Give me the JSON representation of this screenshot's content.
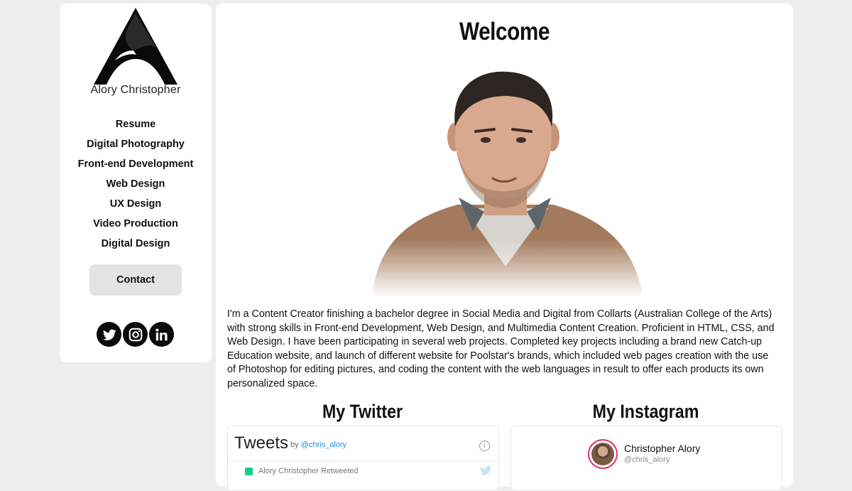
{
  "sidebar": {
    "logo_name": "Alory Christopher",
    "nav": [
      "Resume",
      "Digital Photography",
      "Front-end Development",
      "Web Design",
      "UX Design",
      "Video Production",
      "Digital Design"
    ],
    "contact_label": "Contact",
    "socials": [
      "twitter-icon",
      "instagram-icon",
      "linkedin-icon"
    ]
  },
  "main": {
    "title": "Welcome",
    "bio": "I'm a Content Creator finishing a bachelor degree in Social Media and Digital from Collarts (Australian College of the Arts) with strong skills in Front-end Development, Web Design, and Multimedia Content Creation. Proficient in HTML, CSS, and Web Design. I have been participating in several web projects. Completed key projects including a brand new Catch-up Education website, and launch of different website for Poolstar's brands, which included web pages creation with the use of Photoshop for editing pictures, and coding the content with the web languages in result to offer each products its own personalized space.",
    "twitter_title": "My Twitter",
    "instagram_title": "My Instagram"
  },
  "twitter": {
    "heading": "Tweets",
    "by": "by",
    "handle": "@chris_alory",
    "retweet_text": "Alory Christopher Retweeted"
  },
  "instagram": {
    "name": "Christopher Alory",
    "handle": "@chris_alory"
  },
  "colors": {
    "background": "#efeeee",
    "panel": "#ffffff",
    "contact_button": "#e3e3e3",
    "twitter_link": "#1b95e0",
    "instagram_ring": "#e1306c"
  }
}
